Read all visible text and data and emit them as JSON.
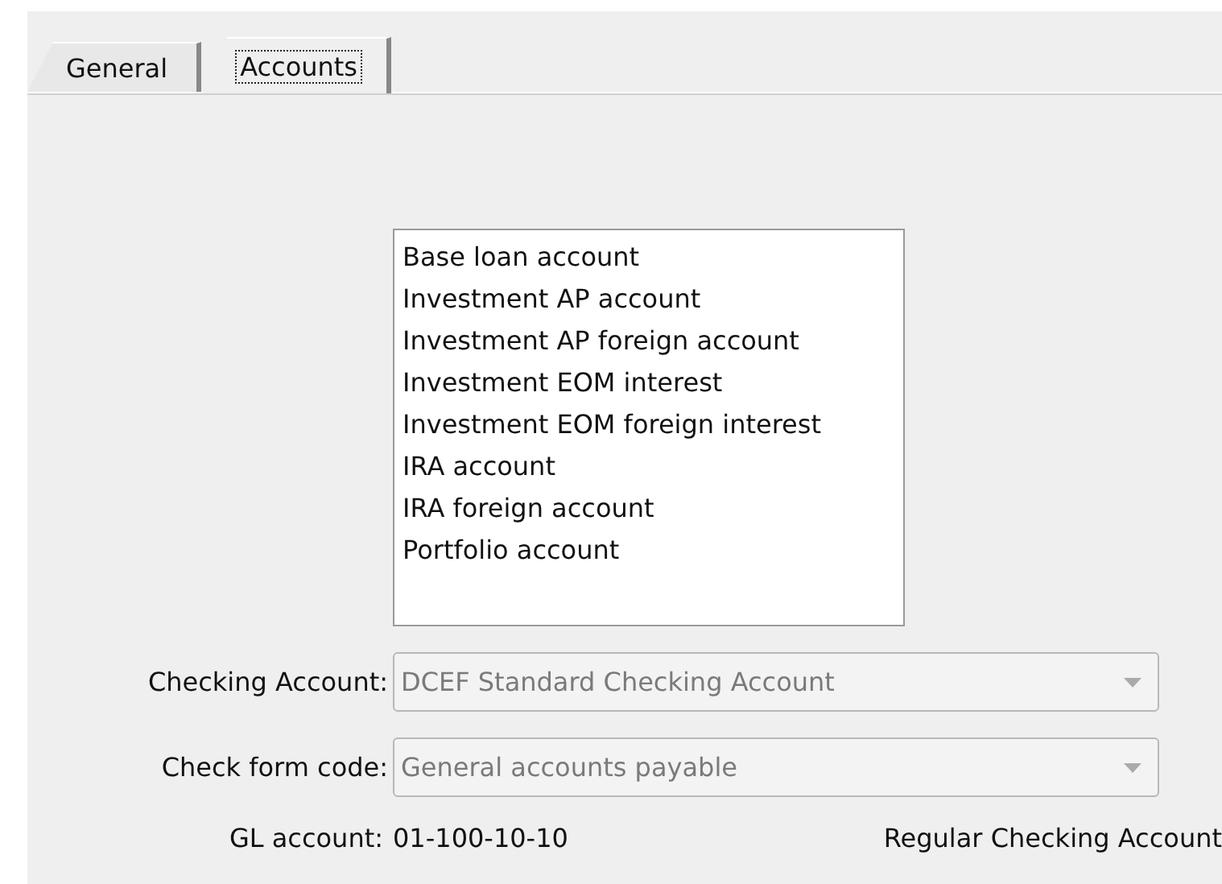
{
  "tabs": [
    {
      "label": "General",
      "selected": false
    },
    {
      "label": "Accounts",
      "selected": true
    }
  ],
  "account_list": {
    "items": [
      "Base loan account",
      "Investment AP account",
      "Investment AP foreign account",
      "Investment EOM interest",
      "Investment EOM foreign interest",
      "IRA account",
      "IRA foreign account",
      "Portfolio account"
    ]
  },
  "fields": [
    {
      "label": "Checking Account:",
      "value": "DCEF Standard Checking Account",
      "disabled": true
    },
    {
      "label": "Check form code:",
      "value": "General accounts payable",
      "disabled": true
    }
  ],
  "gl": {
    "label": "GL account:",
    "value": "01-100-10-10",
    "description": "Regular Checking Account"
  }
}
